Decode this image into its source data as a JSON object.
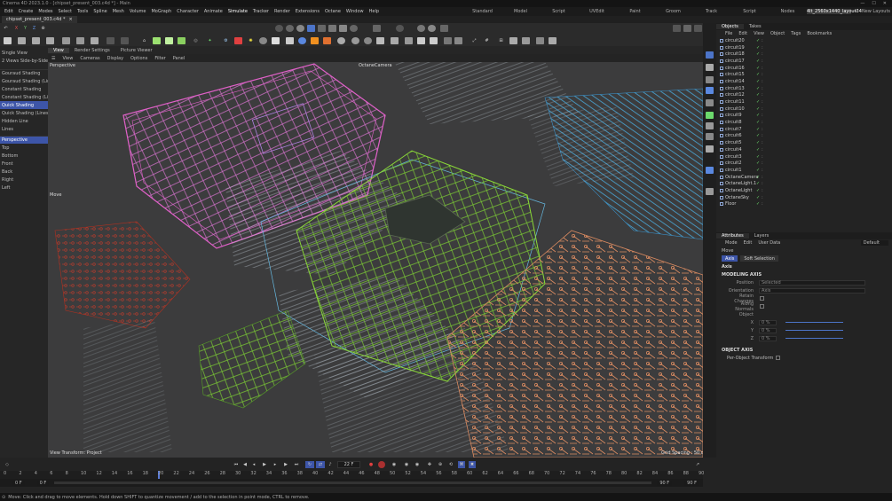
{
  "window": {
    "title": "Cinema 4D 2023.1.0 - [chipset_present_003.c4d *] - Main"
  },
  "menubar": {
    "items": [
      "Edit",
      "Create",
      "Modes",
      "Select",
      "Tools",
      "Spline",
      "Mesh",
      "Volume",
      "MoGraph",
      "Character",
      "Animate",
      "Simulate",
      "Tracker",
      "Render",
      "Extensions",
      "Octane",
      "Window",
      "Help"
    ],
    "layouts": [
      "Standard",
      "Model",
      "Script",
      "UVEdit",
      "Paint",
      "Groom",
      "Track",
      "Script",
      "Nodes"
    ],
    "active_layout": "4lt_2560x1440_layout34",
    "new_layouts": "New Layouts"
  },
  "doc_tab": {
    "label": "chipset_present_003.c4d *"
  },
  "viewport_tabs": [
    {
      "label": "View"
    },
    {
      "label": "Render Settings"
    },
    {
      "label": "Picture Viewer"
    }
  ],
  "viewport_menu": [
    "View",
    "Cameras",
    "Display",
    "Options",
    "Filter",
    "Panel"
  ],
  "viewport": {
    "label": "Perspective",
    "camera": "OctaneCamera",
    "tool": "Move",
    "transform": "View Transform: Project",
    "grid": "Grid Spacing : 50 cm"
  },
  "left_panel": {
    "layout_items": [
      "Single View",
      "2 Views Side-by-Side"
    ],
    "shading_items": [
      "Gouraud Shading",
      "Gouraud Shading (Lines)",
      "Constant Shading",
      "Constant Shading (Lines)",
      "Quick Shading",
      "Quick Shading (Lines)",
      "Hidden Line",
      "Lines"
    ],
    "active_shading": "Quick Shading",
    "view_items": [
      "Perspective",
      "Top",
      "Bottom",
      "Front",
      "Back",
      "Right",
      "Left"
    ],
    "active_view": "Perspective"
  },
  "objects_panel": {
    "tabs": [
      "Objects",
      "Takes"
    ],
    "menu": [
      "File",
      "Edit",
      "View",
      "Object",
      "Tags",
      "Bookmarks"
    ],
    "items": [
      "circuit20",
      "circuit19",
      "circuit18",
      "circuit17",
      "circuit16",
      "circuit15",
      "circuit14",
      "circuit13",
      "circuit12",
      "circuit11",
      "circuit10",
      "circuit9",
      "circuit8",
      "circuit7",
      "circuit6",
      "circuit5",
      "circuit4",
      "circuit3",
      "circuit2",
      "circuit1",
      "OctaneCamera",
      "OctaneLight.1",
      "OctaneLight",
      "OctaneSky",
      "Floor"
    ]
  },
  "attributes_panel": {
    "tabs": [
      "Attributes",
      "Layers"
    ],
    "menu": [
      "Mode",
      "Edit",
      "User Data"
    ],
    "preset": "Default",
    "object_name": "Move",
    "buttons": [
      "Axis",
      "Soft Selection"
    ],
    "section_title": "Axis",
    "modeling_axis": "MODELING AXIS",
    "position_label": "Position",
    "position_value": "Selected",
    "orientation_label": "Orientation",
    "orientation_value": "Axis",
    "retain_label": "Retain Changes",
    "along_normals_label": "Along Normals",
    "object_label": "Object",
    "x_label": "X",
    "y_label": "Y",
    "z_label": "Z",
    "x_value": "0 %",
    "y_value": "0 %",
    "z_value": "0 %",
    "object_axis": "OBJECT AXIS",
    "per_object_label": "Per-Object Transform"
  },
  "timeline": {
    "ticks": [
      "0",
      "2",
      "4",
      "6",
      "8",
      "10",
      "12",
      "14",
      "16",
      "18",
      "20",
      "22",
      "24",
      "26",
      "28",
      "30",
      "32",
      "34",
      "36",
      "38",
      "40",
      "42",
      "44",
      "46",
      "48",
      "50",
      "52",
      "54",
      "56",
      "58",
      "60",
      "62",
      "64",
      "66",
      "68",
      "70",
      "72",
      "74",
      "76",
      "78",
      "80",
      "82",
      "84",
      "86",
      "88",
      "90"
    ],
    "current_frame": "22 F",
    "start": "0 F",
    "start2": "0 F",
    "end": "90 F",
    "end2": "90 F"
  },
  "status": {
    "text": "Move: Click and drag to move elements. Hold down SHIFT to quantize movement / add to the selection in point mode, CTRL to remove."
  }
}
